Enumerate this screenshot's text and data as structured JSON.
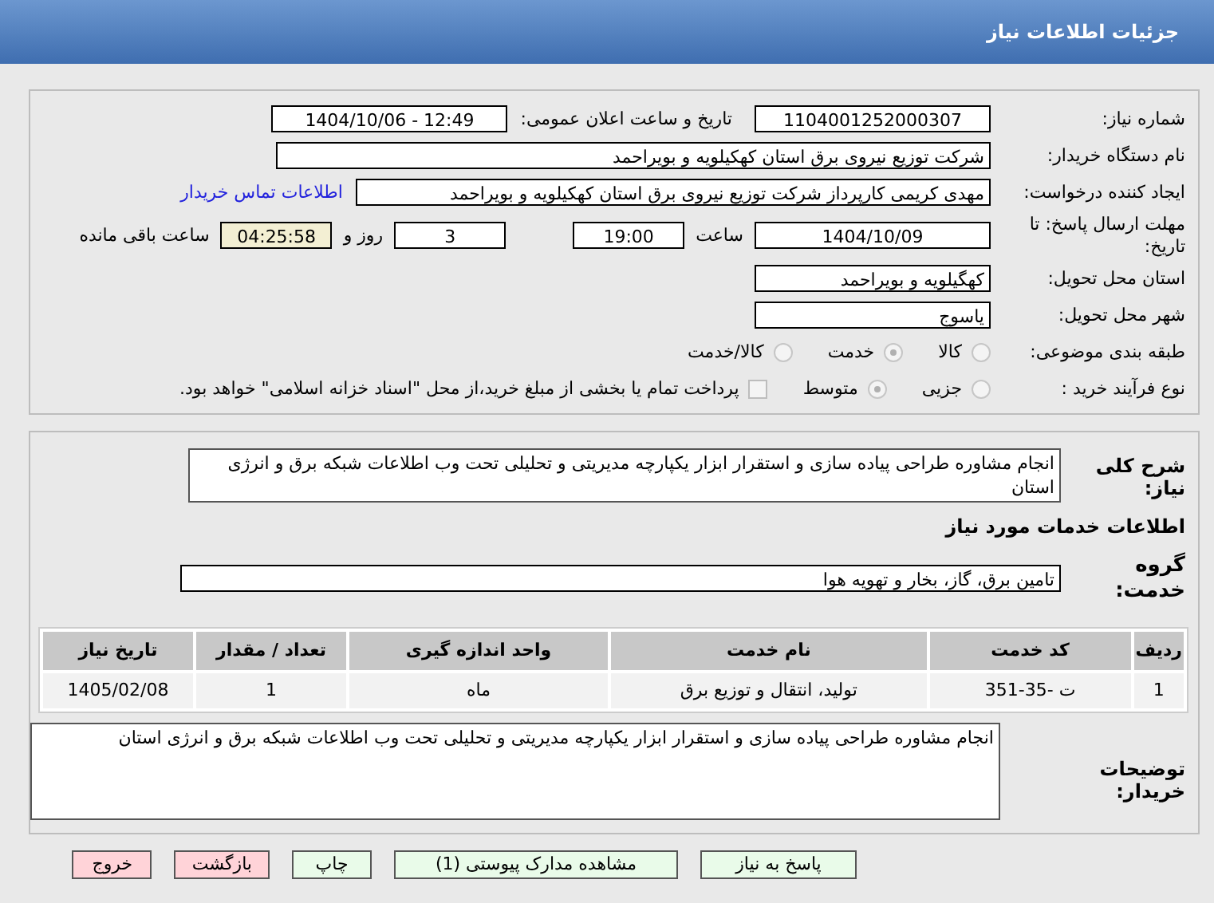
{
  "header": {
    "title": "جزئیات اطلاعات نیاز"
  },
  "need_number": {
    "label": "شماره نیاز:",
    "value": "1104001252000307"
  },
  "announce": {
    "label": "تاریخ و ساعت اعلان عمومی:",
    "value": "1404/10/06 - 12:49"
  },
  "buyer": {
    "label": "نام دستگاه خریدار:",
    "value": "شرکت توزیع نیروی برق استان کهکیلویه و بویراحمد"
  },
  "creator": {
    "label": "ایجاد کننده درخواست:",
    "value": "مهدی کریمی کارپرداز شرکت توزیع نیروی برق استان کهکیلویه و بویراحمد",
    "link": "اطلاعات تماس خریدار"
  },
  "deadline": {
    "label": "مهلت ارسال پاسخ: تا تاریخ:",
    "date": "1404/10/09",
    "time_label": "ساعت",
    "time": "19:00",
    "days": "3",
    "days_label": "روز و",
    "remaining": "04:25:58",
    "remaining_label": "ساعت باقی مانده"
  },
  "province": {
    "label": "استان محل تحویل:",
    "value": "کهگیلویه و بویراحمد"
  },
  "city": {
    "label": "شهر محل تحویل:",
    "value": "یاسوج"
  },
  "category": {
    "label": "طبقه بندی موضوعی:",
    "options": [
      {
        "label": "کالا",
        "selected": false
      },
      {
        "label": "خدمت",
        "selected": true
      },
      {
        "label": "کالا/خدمت",
        "selected": false
      }
    ]
  },
  "process": {
    "label": "نوع فرآیند خرید :",
    "options": [
      {
        "label": "جزیی",
        "selected": false
      },
      {
        "label": "متوسط",
        "selected": true
      }
    ],
    "payment": {
      "checked": false,
      "text": "پرداخت تمام یا بخشی از مبلغ خرید،از محل \"اسناد خزانه اسلامی\" خواهد بود."
    }
  },
  "description": {
    "label": "شرح کلی نیاز:",
    "value": "انجام مشاوره طراحی پیاده سازی و استقرار ابزار یکپارچه مدیریتی و تحلیلی تحت وب اطلاعات شبکه برق و انرژی استان"
  },
  "services_heading": "اطلاعات خدمات مورد نیاز",
  "service_group": {
    "label": "گروه خدمت:",
    "value": "تامین برق، گاز، بخار و تهویه هوا"
  },
  "table": {
    "columns": [
      "ردیف",
      "کد خدمت",
      "نام خدمت",
      "واحد اندازه گیری",
      "تعداد / مقدار",
      "تاریخ نیاز"
    ],
    "rows": [
      [
        "1",
        "ت -35-351",
        "تولید، انتقال و توزیع برق",
        "ماه",
        "1",
        "1405/02/08"
      ]
    ]
  },
  "buyer_notes": {
    "label": "توضیحات خریدار:",
    "value": "انجام مشاوره طراحی پیاده سازی و استقرار ابزار یکپارچه مدیریتی و تحلیلی تحت وب اطلاعات شبکه برق و انرژی استان"
  },
  "buttons": [
    {
      "label": "پاسخ به نیاز",
      "kind": "action"
    },
    {
      "label": "مشاهده مدارک پیوستی (1)",
      "kind": "action"
    },
    {
      "label": "چاپ",
      "kind": "action"
    },
    {
      "label": "بازگشت",
      "kind": "exit"
    },
    {
      "label": "خروج",
      "kind": "exit"
    }
  ]
}
